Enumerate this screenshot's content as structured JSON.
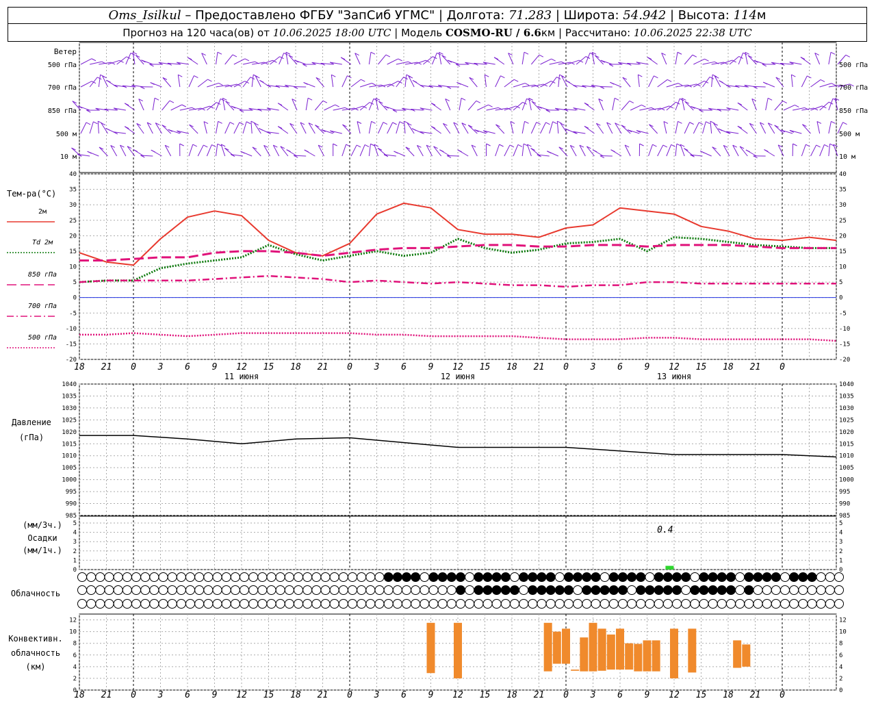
{
  "header": {
    "station": "Oms_Isilkul",
    "provider": " – Предоставлено ФГБУ \"ЗапСиб УГМС\" | Долгота: ",
    "lon": "71.283",
    "lat_label": " | Широта: ",
    "lat": "54.942",
    "alt_label": " | Высота: ",
    "alt": "114",
    "alt_unit": "м",
    "forecast_prefix": "Прогноз на 120 часа(ов) от ",
    "forecast_from": "10.06.2025 18:00 UTC",
    "model_label": " | Модель ",
    "model": "COSMO-RU / 6.6",
    "model_unit": "км",
    "calc_label": " | Рассчитано: ",
    "calc_time": "10.06.2025 22:38 UTC"
  },
  "wind": {
    "title": "Ветер",
    "levels": [
      "500 гПа",
      "700 гПа",
      "850 гПа",
      "500 м",
      "10  м"
    ],
    "color": "#7a1fd0"
  },
  "temperature": {
    "title": "Тем-ра(°С)",
    "ylim": [
      -20,
      40
    ],
    "yticks": [
      -20,
      -15,
      -10,
      -5,
      0,
      5,
      10,
      15,
      20,
      25,
      30,
      35,
      40
    ],
    "legend": [
      {
        "label": "2м",
        "color": "#e8392e",
        "style": "solid"
      },
      {
        "label": "Td  2м",
        "color": "#0c7a0c",
        "style": "dotted"
      },
      {
        "label": "850 гПа",
        "color": "#e0127a",
        "style": "dash"
      },
      {
        "label": "700 гПа",
        "color": "#e0127a",
        "style": "dashdot"
      },
      {
        "label": "500 гПа",
        "color": "#e0127a",
        "style": "dotted"
      }
    ]
  },
  "pressure": {
    "title": "Давление",
    "unit": "(гПа)",
    "ylim": [
      985,
      1040
    ],
    "yticks": [
      985,
      990,
      995,
      1000,
      1005,
      1010,
      1015,
      1020,
      1025,
      1030,
      1035,
      1040
    ]
  },
  "precip": {
    "title_1": "(мм/3ч.)",
    "title_2": "Осадки",
    "title_3": "(мм/1ч.)",
    "yticks": [
      0,
      1,
      2,
      3,
      4,
      5
    ],
    "annotation": "0.4"
  },
  "cloud": {
    "title": "Облачность"
  },
  "convective": {
    "title_1": "Конвективн.",
    "title_2": "облачность",
    "title_3": "(км)",
    "yticks": [
      0,
      2,
      4,
      6,
      8,
      10,
      12
    ]
  },
  "time_axis": {
    "hour_labels": [
      "18",
      "21",
      "0",
      "3",
      "6",
      "9",
      "12",
      "15",
      "18",
      "21",
      "0",
      "3",
      "6",
      "9",
      "12",
      "15",
      "18",
      "21",
      "0",
      "3",
      "6",
      "9",
      "12",
      "15",
      "18",
      "21",
      "0"
    ],
    "days": [
      "11 июня",
      "12 июня",
      "13 июня"
    ]
  },
  "chart_data": [
    {
      "type": "line",
      "title": "Тем-ра(°С)",
      "x": [
        -6,
        -3,
        0,
        3,
        6,
        9,
        12,
        15,
        18,
        21,
        24,
        27,
        30,
        33,
        36,
        39,
        42,
        45,
        48,
        51,
        54,
        57,
        60,
        63,
        66,
        69,
        72,
        75,
        78
      ],
      "x_unit": "hours from 11 June 00 UTC",
      "series": [
        {
          "name": "2м",
          "values": [
            14.5,
            11.5,
            10.5,
            19,
            26,
            28,
            26.5,
            18.5,
            14.5,
            13.5,
            17.5,
            27,
            30.5,
            29,
            22,
            20.5,
            20.5,
            19.5,
            22.5,
            23.5,
            29,
            28,
            27,
            23,
            21.5,
            19,
            18.5,
            19.5,
            18.5
          ]
        },
        {
          "name": "Td  2м",
          "values": [
            5,
            5.5,
            5.5,
            9.5,
            11,
            12,
            13,
            17,
            14,
            12,
            13.5,
            15,
            13.5,
            14.5,
            19,
            16,
            14.5,
            15.5,
            17.5,
            18,
            19,
            15,
            19.5,
            19,
            18,
            17,
            16.5,
            16,
            16
          ]
        },
        {
          "name": "850 гПа",
          "values": [
            12,
            12,
            12.5,
            13,
            13,
            14.5,
            15,
            15,
            14.5,
            13.5,
            14.5,
            15.5,
            16,
            16,
            16.5,
            17,
            17,
            16.5,
            16.5,
            17,
            17,
            16.5,
            17,
            17,
            17,
            16.5,
            16,
            16,
            16
          ]
        },
        {
          "name": "700 гПа",
          "values": [
            5,
            5.5,
            5.5,
            5.5,
            5.5,
            6,
            6.5,
            7,
            6.5,
            6,
            5,
            5.5,
            5,
            4.5,
            5,
            4.5,
            4,
            4,
            3.5,
            4,
            4,
            5,
            5,
            4.5,
            4.5,
            4.5,
            4.5,
            4.5,
            4.5
          ]
        },
        {
          "name": "500 гПа",
          "values": [
            -12,
            -12,
            -11.5,
            -12,
            -12.5,
            -12,
            -11.5,
            -11.5,
            -11.5,
            -11.5,
            -11.5,
            -12,
            -12,
            -12.5,
            -12.5,
            -12.5,
            -12.5,
            -13,
            -13.5,
            -13.5,
            -13.5,
            -13,
            -13,
            -13.5,
            -13.5,
            -13.5,
            -13.5,
            -13.5,
            -14
          ]
        }
      ],
      "ylim": [
        -20,
        40
      ]
    },
    {
      "type": "line",
      "title": "Давление",
      "x": [
        -6,
        0,
        6,
        12,
        18,
        24,
        30,
        36,
        42,
        48,
        54,
        60,
        66,
        72,
        78
      ],
      "values": [
        1018.5,
        1018.5,
        1017,
        1015,
        1017,
        1017.5,
        1015.5,
        1013.5,
        1013.5,
        1013.5,
        1012,
        1010.5,
        1010.5,
        1010.5,
        1009.5
      ],
      "ylim": [
        985,
        1040
      ]
    },
    {
      "type": "bar",
      "title": "Осадки",
      "x": [
        59.5
      ],
      "values": [
        0.4
      ],
      "ylim": [
        0,
        5
      ]
    },
    {
      "type": "bar",
      "title": "Конвективная облачность (км)",
      "x": [
        33,
        36,
        46,
        47,
        48,
        49,
        50,
        51,
        52,
        53,
        54,
        55,
        56,
        57,
        58,
        60,
        62,
        67,
        68
      ],
      "bottoms": [
        2.9,
        2,
        3.2,
        4.5,
        4.5,
        3.3,
        3.2,
        3.2,
        3.3,
        3.5,
        3.5,
        3.5,
        3.2,
        3.2,
        3.2,
        2,
        3,
        3.8,
        4
      ],
      "tops": [
        11.5,
        11.5,
        11.5,
        10,
        10.5,
        3.5,
        9,
        11.5,
        10.5,
        9.5,
        10.5,
        8,
        7.9,
        8.5,
        8.5,
        10.5,
        10.5,
        8.5,
        7.8
      ],
      "ylim": [
        0,
        13
      ]
    }
  ]
}
